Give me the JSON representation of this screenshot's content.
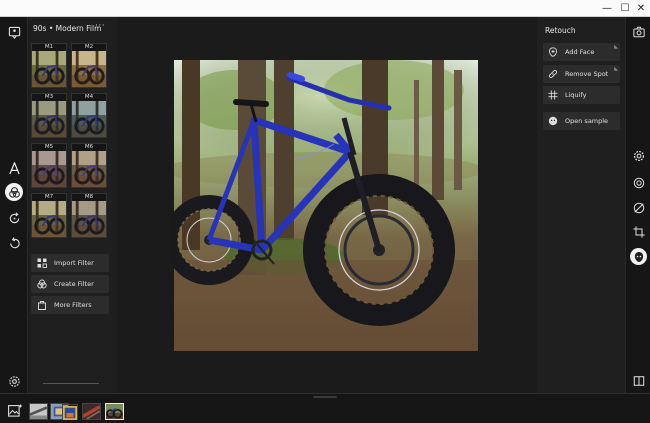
{
  "window": {
    "controls": {
      "minimize": "—",
      "maximize": "☐",
      "close": "✕"
    }
  },
  "left_rail": {
    "icons": [
      "feedback-icon",
      "text-icon",
      "filters-icon",
      "rotate-icon",
      "undo-icon",
      "settings-icon"
    ],
    "active": "filters-icon"
  },
  "filter_panel": {
    "title": "90s • Modern Film",
    "more": "···",
    "thumbnails": [
      {
        "label": "M1"
      },
      {
        "label": "M2"
      },
      {
        "label": "M3"
      },
      {
        "label": "M4"
      },
      {
        "label": "M5"
      },
      {
        "label": "M6"
      },
      {
        "label": "M7"
      },
      {
        "label": "M8"
      }
    ],
    "buttons": {
      "import": "Import Filter",
      "create": "Create Filter",
      "more": "More Filters"
    }
  },
  "retouch_panel": {
    "title": "Retouch",
    "buttons": {
      "add_face": "Add Face",
      "remove_spot": "Remove Spot",
      "liquify": "Liquify",
      "open_sample": "Open sample"
    }
  },
  "right_rail": {
    "icons": [
      "camera-icon",
      "adjust-icon",
      "vignette-icon",
      "blur-icon",
      "crop-icon",
      "retouch-icon",
      "compare-icon"
    ],
    "active": "retouch-icon"
  },
  "colors": {
    "background": "#1b1b1b",
    "panel": "#1f1f1f",
    "button": "#2c2c2c",
    "bike_blue": "#2733b8"
  }
}
